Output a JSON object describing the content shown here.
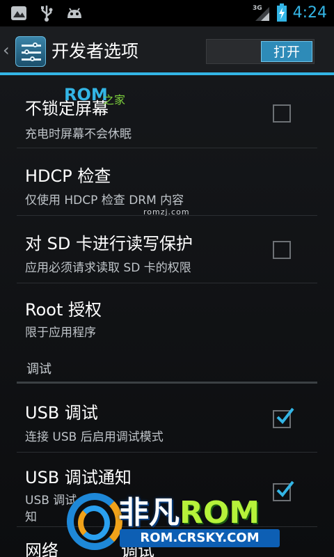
{
  "status_bar": {
    "icons": [
      "picture-icon",
      "usb-icon",
      "android-debug-icon",
      "signal-3g-icon",
      "battery-charging-icon"
    ],
    "network": "3G",
    "time": "4:24",
    "accent": "#33b5e5"
  },
  "action_bar": {
    "back": "‹",
    "title": "开发者选项",
    "toggle_label": "打开"
  },
  "items": [
    {
      "title": "不锁定屏幕",
      "subtitle": "充电时屏幕不会休眠",
      "checkbox": true,
      "checked": false
    },
    {
      "title": "HDCP 检查",
      "subtitle": "仅使用 HDCP 检查 DRM 内容",
      "checkbox": false
    },
    {
      "title": "对 SD 卡进行读写保护",
      "subtitle": "应用必须请求读取 SD 卡的权限",
      "checkbox": true,
      "checked": false
    },
    {
      "title": "Root 授权",
      "subtitle": "限于应用程序",
      "checkbox": false
    }
  ],
  "section": {
    "label": "调试"
  },
  "debug_items": [
    {
      "title": "USB 调试",
      "subtitle": "连接 USB 后启用调试模式",
      "checkbox": true,
      "checked": true
    },
    {
      "title": "USB 调试通知",
      "subtitle": "USB 调试",
      "subtitle2": "知",
      "checkbox": true,
      "checked": true
    },
    {
      "title": "网络",
      "subtitle": "调试",
      "checkbox": false
    }
  ],
  "watermarks": {
    "rom_top": "ROM",
    "home_top": "之家",
    "small": "romzj.com",
    "brand_cn": "非凡",
    "brand_rom": "ROM",
    "brand_url": "ROM.CRSKY.COM"
  }
}
